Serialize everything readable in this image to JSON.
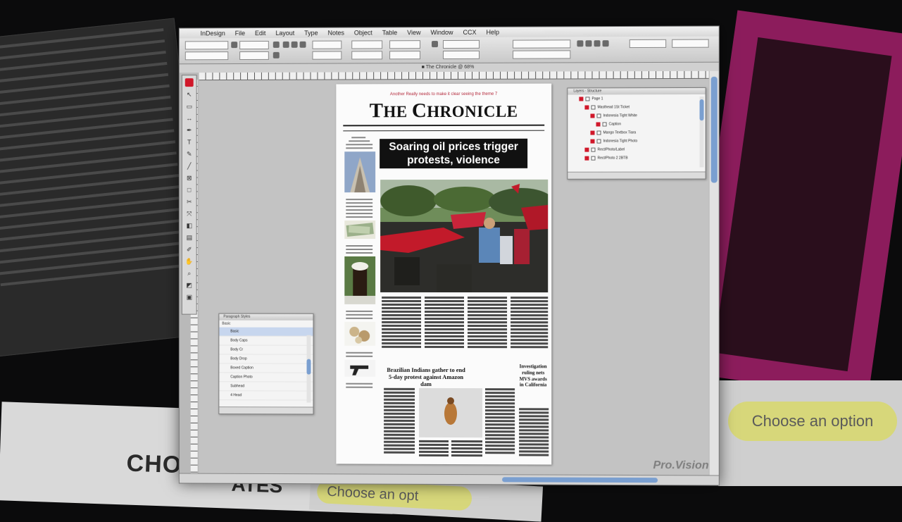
{
  "menubar": {
    "items": [
      "InDesign",
      "File",
      "Edit",
      "Layout",
      "Type",
      "Notes",
      "Object",
      "Table",
      "View",
      "Window",
      "CCX",
      "Help"
    ]
  },
  "newspaper": {
    "kicker": "Another Really needs to make it clear seeing the theme  7",
    "masthead": "The Chronicle",
    "masthead_first": "T",
    "masthead_rest1": "HE ",
    "masthead_c": "C",
    "masthead_rest2": "HRONICLE",
    "headline_line1": "Soaring oil prices trigger",
    "headline_line2": "protests, violence",
    "story2_headline": "Brazilian Indians gather to end 5-day protest against Amazon dam",
    "story3_headline": "Investigation ruling nets MVS awards in California"
  },
  "layers_panel": {
    "rows": [
      {
        "label": "Page 1",
        "indent": 1
      },
      {
        "label": "Masthead 1St Ticket",
        "indent": 2
      },
      {
        "label": "Indonesia Tight White",
        "indent": 3
      },
      {
        "label": "Caption",
        "indent": 4
      },
      {
        "label": "Mango Textbox Tiara",
        "indent": 3
      },
      {
        "label": "Indonesia Tight Photo",
        "indent": 3
      },
      {
        "label": "Rect/Photo/Label",
        "indent": 2
      },
      {
        "label": "Rect/Photo 2 2BTB",
        "indent": 2
      }
    ]
  },
  "pstyles_panel": {
    "title": "Paragraph Styles",
    "current": "Basic",
    "items": [
      "Basic",
      "Body Caps",
      "Body Cr",
      "Body Drop",
      "Boxed Caption",
      "Caption Photo",
      "Subhead",
      "4 Head"
    ],
    "selected_index": 0
  },
  "background": {
    "choose_option_right": "Choose an option",
    "choose_option_bottom": "Choose an opt",
    "bottom_left_big1": "CHOO",
    "bottom_left_big2": "ATES"
  },
  "watermark": "Pro.Vision",
  "colors": {
    "accent_red": "#d0182a",
    "pink_frame": "#8c1c5c",
    "selection_blue": "#7a9fd0"
  }
}
